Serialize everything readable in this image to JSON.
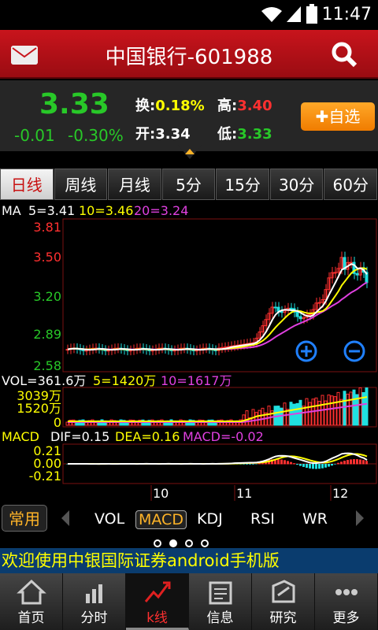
{
  "status": {
    "time": "11:47"
  },
  "header": {
    "title": "中国银行-601988"
  },
  "quote": {
    "price": "3.33",
    "change": "-0.01",
    "change_pct": "-0.30%",
    "turnover_label": "换:",
    "turnover": "0.18%",
    "high_label": "高:",
    "high": "3.40",
    "open_label": "开:",
    "open": "3.34",
    "low_label": "低:",
    "low": "3.33",
    "add_label": "✚自选"
  },
  "tabs": [
    "日线",
    "周线",
    "月线",
    "5分",
    "15分",
    "30分",
    "60分"
  ],
  "chart_data": [
    {
      "type": "candlestick",
      "title": "MA",
      "ma": [
        {
          "name": "5=3.41",
          "color": "#ffffff"
        },
        {
          "name": "10=3.46",
          "color": "#ffff00"
        },
        {
          "name": "20=3.24",
          "color": "#e040e0"
        }
      ],
      "yticks": [
        "3.81",
        "3.50",
        "3.20",
        "2.89",
        "2.58"
      ],
      "ylim": [
        2.58,
        3.81
      ],
      "xticks": [
        "10",
        "11",
        "12"
      ]
    },
    {
      "type": "bar",
      "title": "VOL=361.6万",
      "series": [
        {
          "name": "5=1420万",
          "color": "#ffff00"
        },
        {
          "name": "10=1617万",
          "color": "#e040e0"
        }
      ],
      "yticks": [
        "3039万",
        "1520万",
        "0"
      ]
    },
    {
      "type": "bar",
      "title": "MACD",
      "series": [
        {
          "name": "DIF=0.15",
          "color": "#ffffff"
        },
        {
          "name": "DEA=0.16",
          "color": "#ffff00"
        },
        {
          "name": "MACD=-0.02",
          "color": "#e040e0"
        }
      ],
      "yticks": [
        "0.21",
        "0.00",
        "-0.21"
      ]
    }
  ],
  "indicators": {
    "common": "常用",
    "items": [
      "VOL",
      "MACD",
      "KDJ",
      "RSI",
      "WR"
    ],
    "active": "MACD"
  },
  "marquee": "欢迎使用中银国际证券android手机版",
  "nav": [
    "首页",
    "分时",
    "k线",
    "信息",
    "研究",
    "更多"
  ]
}
